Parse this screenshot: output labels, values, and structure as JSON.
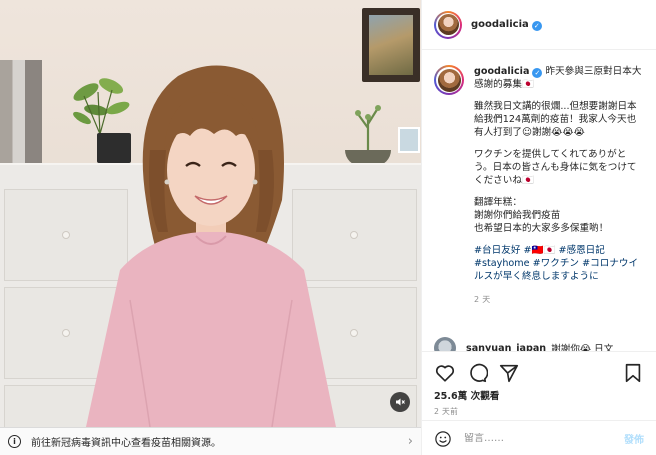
{
  "post": {
    "username": "goodalicia",
    "verified_icon": "verified-badge-icon",
    "caption": {
      "line1": "昨天參與三原對日本大感謝的募集🇯🇵",
      "para2": "雖然我日文講的很爛...但想要謝謝日本給我們124萬劑的疫苗！我家人今天也有人打到了☺謝謝😭😭😭",
      "para3": "ワクチンを提供してくれてありがとう。日本の皆さんも身体に気をつけてくださいね🇯🇵",
      "para4_label": "翻譯年糕：",
      "para4_line1": "謝謝你們給我們疫苗",
      "para4_line2": "也希望日本的大家多多保重喲！",
      "hashtags": "#台日友好 #🇹🇼🇯🇵 #感恩日記 #stayhome #ワクチン #コロナウイルスが早く終息しますように",
      "time": "2 天"
    },
    "comment": {
      "username": "sanyuan_japan",
      "text": "謝謝你😭 日文"
    },
    "views": "25.6萬 次觀看",
    "posted": "2 天前",
    "comment_placeholder": "留言……",
    "post_button": "發佈"
  },
  "banner": {
    "text": "前往新冠病毒資訊中心查看疫苗相關資源。",
    "info_icon": "info-icon",
    "chevron_icon": "chevron-right-icon"
  },
  "colors": {
    "link": "#00376b",
    "verified": "#3897f0",
    "post_button_disabled": "#b2dffc",
    "muted_text": "#8e8e8e"
  }
}
